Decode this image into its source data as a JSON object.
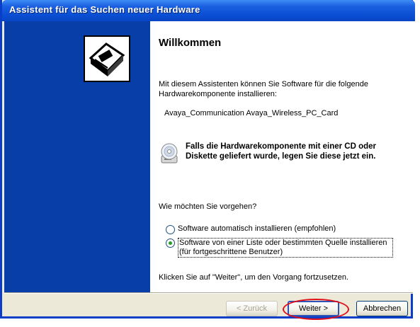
{
  "window": {
    "title": "Assistent für das Suchen neuer Hardware"
  },
  "wizard": {
    "heading": "Willkommen",
    "intro": "Mit diesem Assistenten können Sie Software für die folgende Hardwarekomponente installieren:",
    "device_name": "Avaya_Communication Avaya_Wireless_PC_Card",
    "cd_note": "Falls die Hardwarekomponente mit einer CD oder Diskette geliefert wurde, legen Sie diese jetzt ein.",
    "question": "Wie möchten Sie vorgehen?",
    "options": [
      {
        "label": "Software automatisch installieren (empfohlen)",
        "selected": false
      },
      {
        "label": "Software von einer Liste oder bestimmten Quelle installieren (für fortgeschrittene Benutzer)",
        "selected": true
      }
    ],
    "continue_hint": "Klicken Sie auf \"Weiter\", um den Vorgang fortzusetzen."
  },
  "buttons": {
    "back": "< Zurück",
    "next": "Weiter >",
    "cancel": "Abbrechen"
  },
  "icons": {
    "sidebar": "hardware-install-icon",
    "cd": "cd-drive-icon"
  },
  "colors": {
    "title_bar": "#0a4fd4",
    "sidebar": "#083ea8",
    "highlight": "#e0101a",
    "radio_selected": "#21a121"
  }
}
